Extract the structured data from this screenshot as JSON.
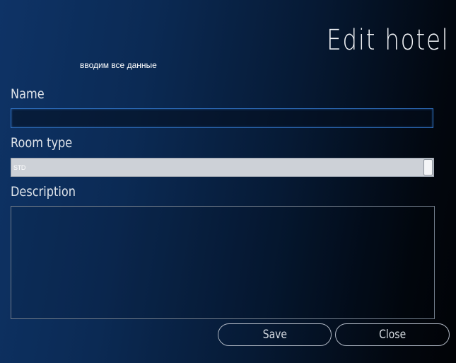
{
  "window": {
    "title": "Edit hotel",
    "hint": "вводим все данные"
  },
  "form": {
    "name": {
      "label": "Name",
      "value": ""
    },
    "room_type": {
      "label": "Room type",
      "selected": "STD"
    },
    "description": {
      "label": "Description",
      "value": ""
    }
  },
  "buttons": {
    "save_label": "Save",
    "close_label": "Close"
  },
  "colors": {
    "background_left": "#0e3366",
    "background_right": "#010306",
    "input_focus_border": "#2e6fbf",
    "select_background": "#cdd1d7"
  }
}
